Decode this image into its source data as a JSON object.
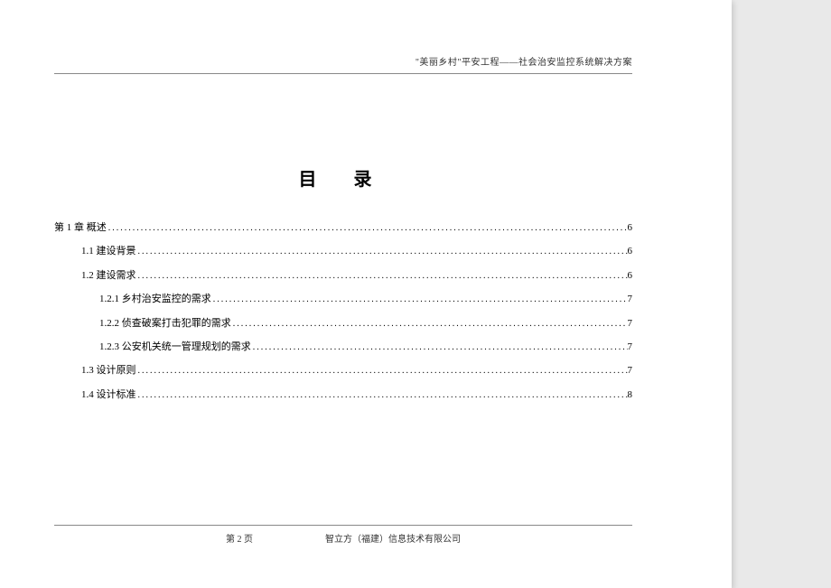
{
  "header": {
    "text": "\"美丽乡村\"平安工程——社会治安监控系统解决方案"
  },
  "toc": {
    "title": "目 录",
    "items": [
      {
        "level": 1,
        "label": "第 1 章  概述",
        "page": "6"
      },
      {
        "level": 2,
        "label": "1.1  建设背景",
        "page": "6"
      },
      {
        "level": 2,
        "label": "1.2  建设需求",
        "page": "6"
      },
      {
        "level": 3,
        "label": "1.2.1  乡村治安监控的需求",
        "page": "7"
      },
      {
        "level": 3,
        "label": "1.2.2  侦查破案打击犯罪的需求",
        "page": "7"
      },
      {
        "level": 3,
        "label": "1.2.3  公安机关统一管理规划的需求",
        "page": "7"
      },
      {
        "level": 2,
        "label": "1.3  设计原则",
        "page": "7"
      },
      {
        "level": 2,
        "label": "1.4  设计标准",
        "page": "8"
      }
    ]
  },
  "footer": {
    "page_label": "第 2 页",
    "company": "智立方（福建）信息技术有限公司"
  }
}
